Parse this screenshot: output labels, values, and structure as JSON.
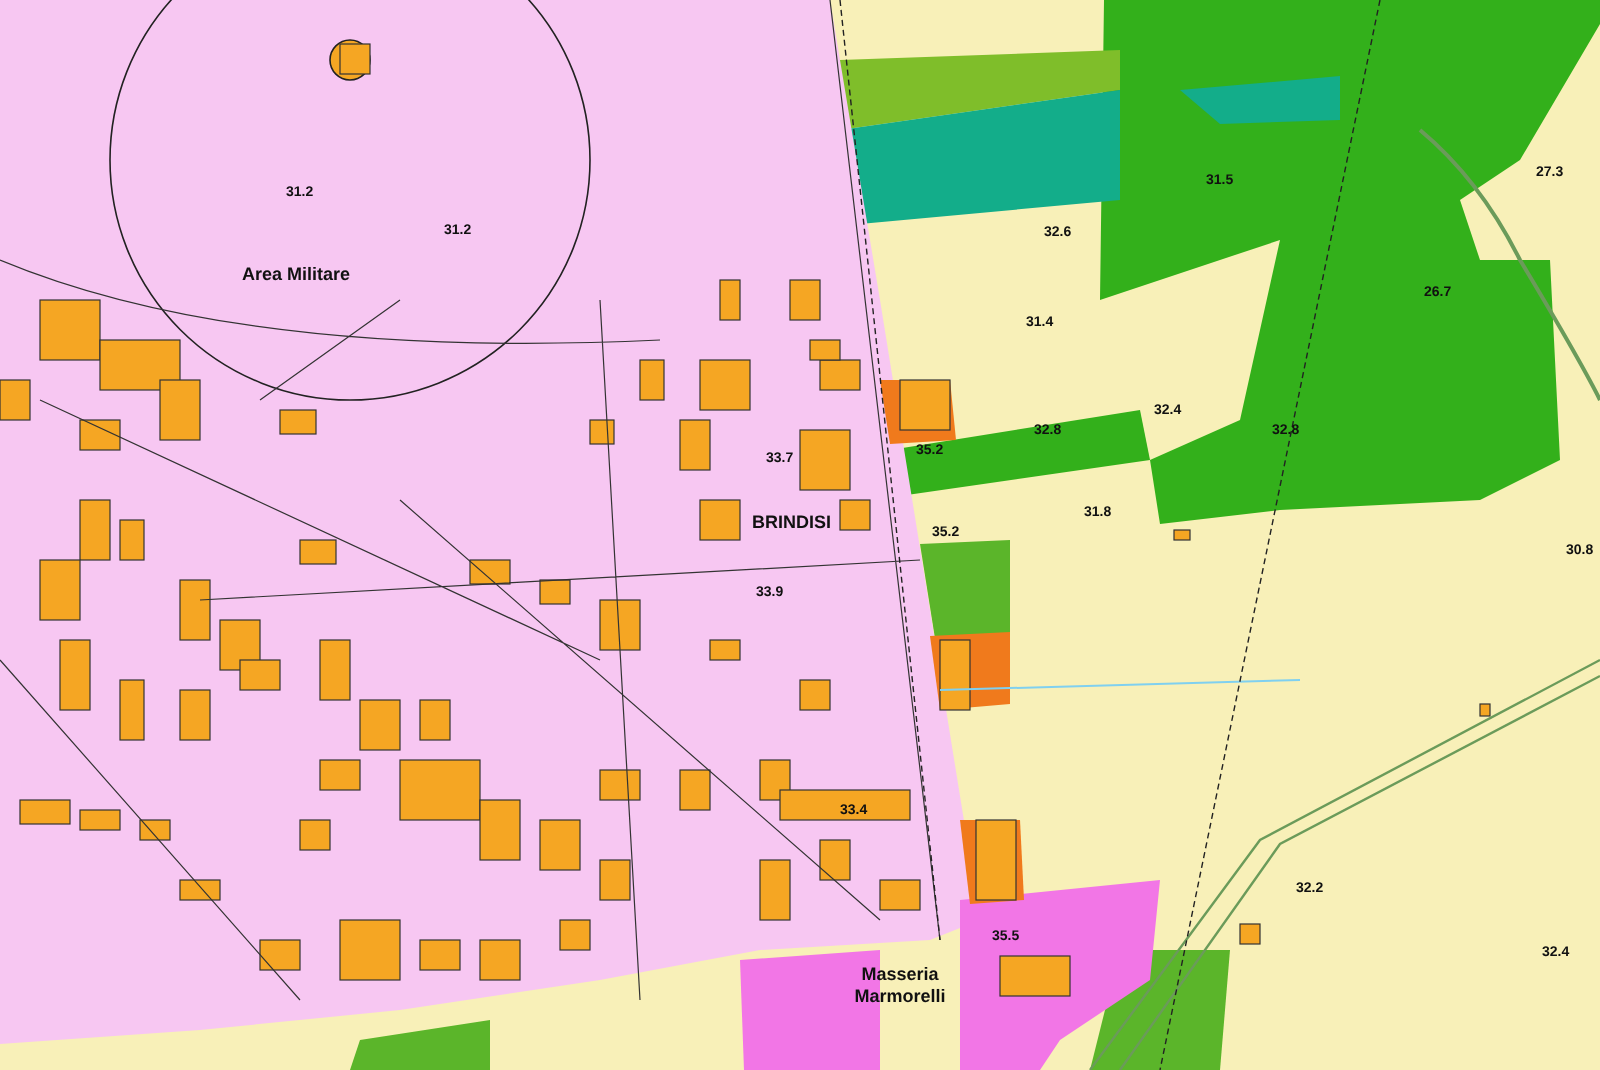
{
  "map": {
    "place_labels": [
      "Area Militare",
      "BRINDISI",
      "Masseria Marmorelli"
    ],
    "spot_heights": [
      "31.2",
      "31.2",
      "32.6",
      "31.4",
      "32.4",
      "32.8",
      "35.2",
      "31.8",
      "35.2",
      "31.5",
      "26.7",
      "32.2",
      "32.4",
      "35.5",
      "33.4",
      "33.7",
      "33.9",
      "27.3",
      "30.8",
      "32.8"
    ]
  }
}
